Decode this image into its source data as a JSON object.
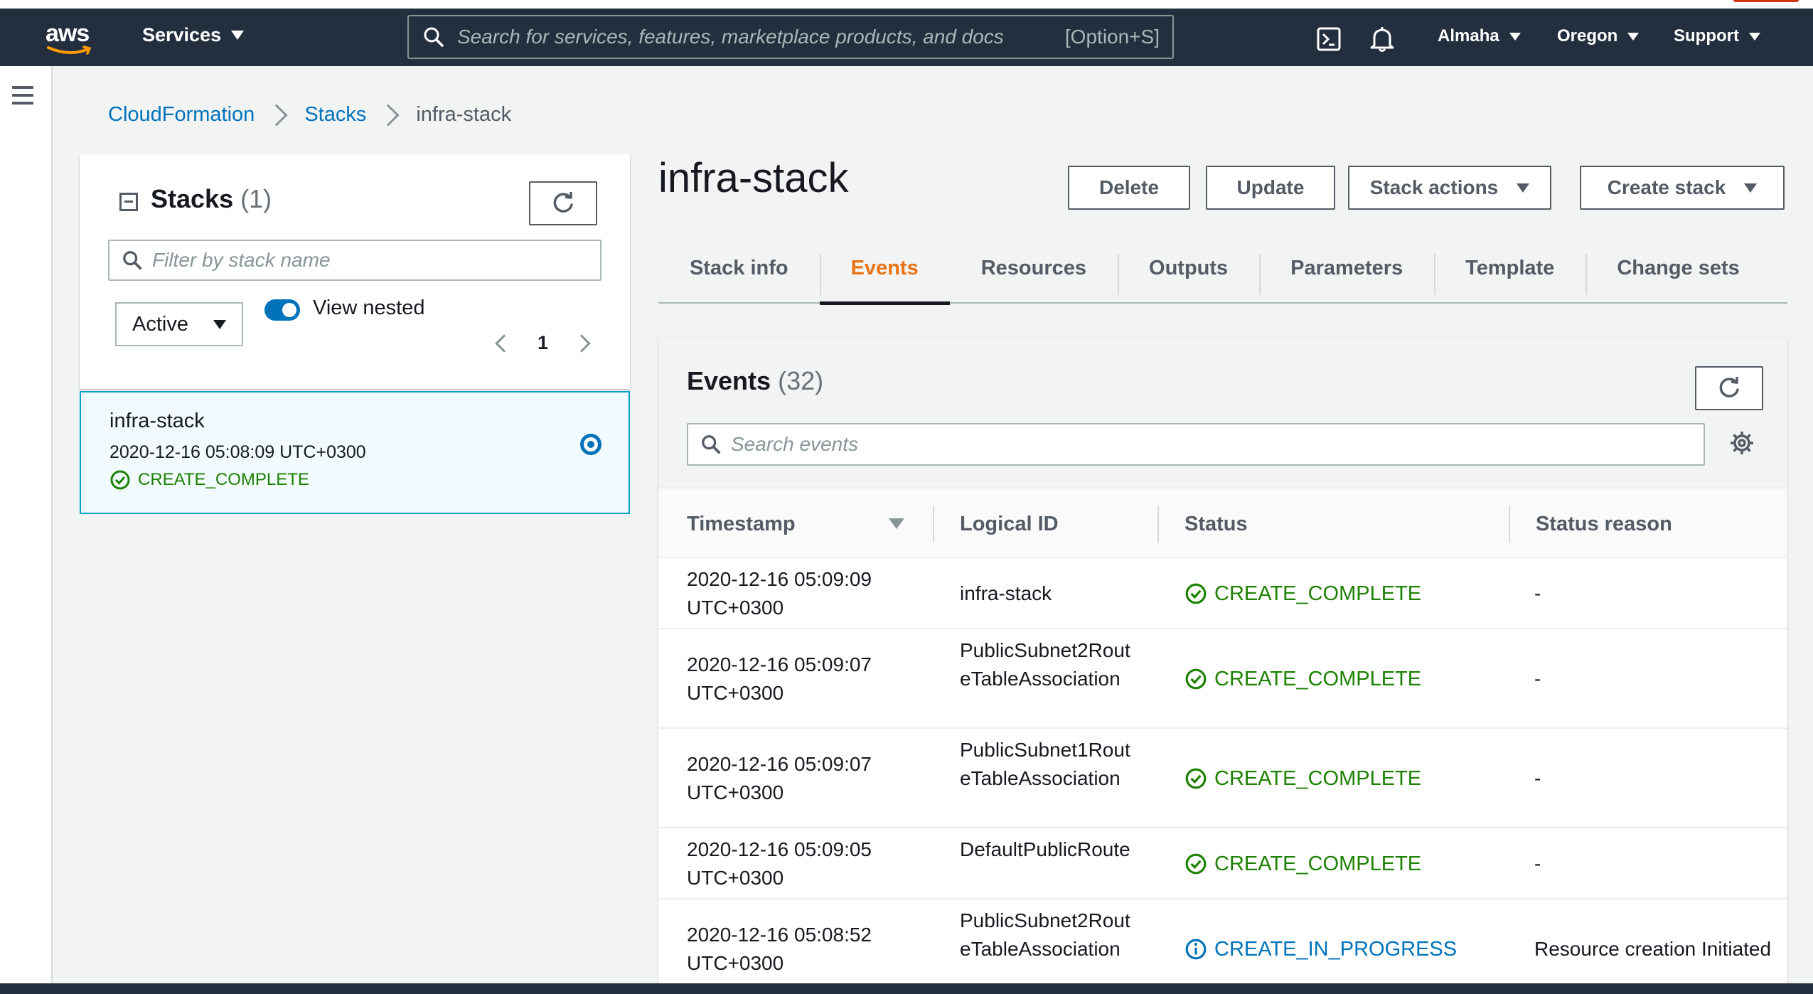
{
  "navbar": {
    "logo_text": "aws",
    "services_label": "Services",
    "search_placeholder": "Search for services, features, marketplace products, and docs",
    "search_shortcut": "[Option+S]",
    "account_label": "Almaha",
    "region_label": "Oregon",
    "support_label": "Support",
    "icons": [
      "cloudshell-icon",
      "bell-icon"
    ]
  },
  "breadcrumb": {
    "items": [
      "CloudFormation",
      "Stacks"
    ],
    "current": "infra-stack"
  },
  "stacks_panel": {
    "title": "Stacks",
    "count": "(1)",
    "filter_placeholder": "Filter by stack name",
    "status_filter": "Active",
    "view_nested_label": "View nested",
    "view_nested_on": true,
    "page": "1",
    "stacks": [
      {
        "name": "infra-stack",
        "created": "2020-12-16 05:08:09 UTC+0300",
        "status": "CREATE_COMPLETE"
      }
    ]
  },
  "stack_detail": {
    "name": "infra-stack",
    "buttons": {
      "delete": "Delete",
      "update": "Update",
      "stack_actions": "Stack actions",
      "create_stack": "Create stack"
    },
    "tabs": [
      "Stack info",
      "Events",
      "Resources",
      "Outputs",
      "Parameters",
      "Template",
      "Change sets"
    ],
    "active_tab": "Events"
  },
  "events": {
    "title": "Events",
    "count": "(32)",
    "search_placeholder": "Search events",
    "columns": [
      "Timestamp",
      "Logical ID",
      "Status",
      "Status reason"
    ],
    "rows": [
      {
        "timestamp": "2020-12-16 05:09:09 UTC+0300",
        "logical_id": "infra-stack",
        "status": "CREATE_COMPLETE",
        "reason": "-"
      },
      {
        "timestamp": "2020-12-16 05:09:07 UTC+0300",
        "logical_id": "PublicSubnet2RouteTableAssociation",
        "status": "CREATE_COMPLETE",
        "reason": "-"
      },
      {
        "timestamp": "2020-12-16 05:09:07 UTC+0300",
        "logical_id": "PublicSubnet1RouteTableAssociation",
        "status": "CREATE_COMPLETE",
        "reason": "-"
      },
      {
        "timestamp": "2020-12-16 05:09:05 UTC+0300",
        "logical_id": "DefaultPublicRoute",
        "status": "CREATE_COMPLETE",
        "reason": "-"
      },
      {
        "timestamp": "2020-12-16 05:08:52 UTC+0300",
        "logical_id": "PublicSubnet2RouteTableAssociation",
        "status": "CREATE_IN_PROGRESS",
        "reason": "Resource creation Initiated"
      }
    ]
  },
  "colors": {
    "navbar_bg": "#232f3e",
    "link": "#0073bb",
    "success": "#1d8102",
    "active_tab": "#ec7211"
  }
}
